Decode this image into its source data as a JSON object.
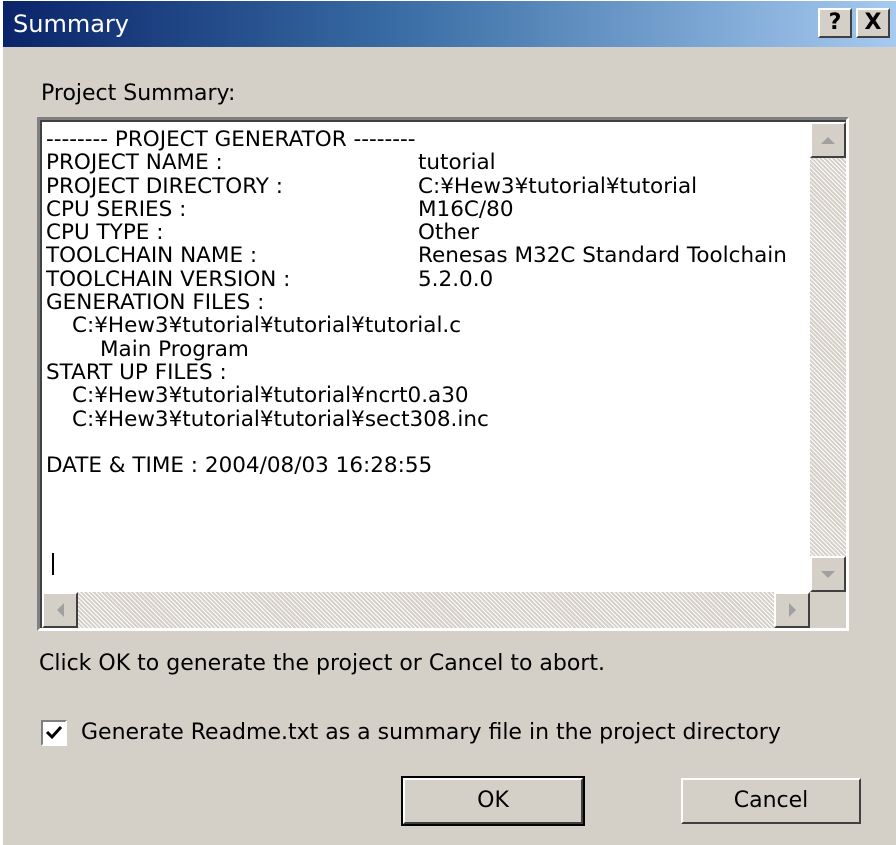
{
  "window": {
    "title": "Summary",
    "help_label": "?",
    "close_label": "X"
  },
  "summary_label": "Project Summary:",
  "summary": {
    "header": "-------- PROJECT GENERATOR --------",
    "fields": [
      {
        "key": "PROJECT NAME :",
        "value": "tutorial"
      },
      {
        "key": "PROJECT DIRECTORY :",
        "value": "C:¥Hew3¥tutorial¥tutorial"
      },
      {
        "key": "CPU SERIES :",
        "value": "M16C/80"
      },
      {
        "key": "CPU TYPE :",
        "value": "Other"
      },
      {
        "key": "TOOLCHAIN NAME :",
        "value": "Renesas M32C Standard Toolchain"
      },
      {
        "key": "TOOLCHAIN VERSION :",
        "value": "5.2.0.0"
      }
    ],
    "generation_files_label": "GENERATION FILES :",
    "generation_file": "C:¥Hew3¥tutorial¥tutorial¥tutorial.c",
    "generation_file_desc": "Main Program",
    "startup_files_label": "START UP FILES :",
    "startup_files": [
      "C:¥Hew3¥tutorial¥tutorial¥ncrt0.a30",
      "C:¥Hew3¥tutorial¥tutorial¥sect308.inc"
    ],
    "date_time": "DATE & TIME : 2004/08/03 16:28:55"
  },
  "instruction": "Click OK to generate the project or Cancel to abort.",
  "readme_checkbox": {
    "label": "Generate Readme.txt as a summary file in the project directory",
    "checked": true
  },
  "buttons": {
    "ok": "OK",
    "cancel": "Cancel"
  },
  "icons": [
    "help-icon",
    "close-icon",
    "scroll-up-arrow-icon",
    "scroll-down-arrow-icon",
    "scroll-left-arrow-icon",
    "scroll-right-arrow-icon",
    "checkmark-icon"
  ],
  "colors": {
    "titlebar_start": "#0a246a",
    "titlebar_end": "#a6caf0",
    "dialog_face": "#d4d0c8"
  }
}
